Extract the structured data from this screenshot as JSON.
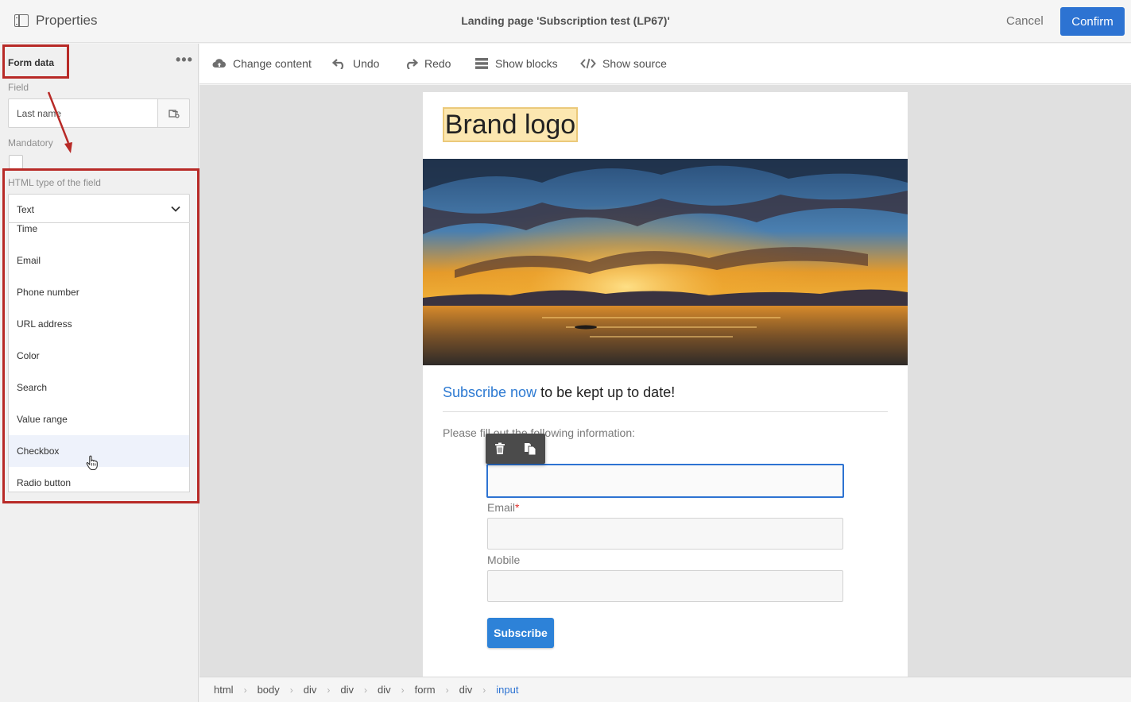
{
  "header": {
    "properties_label": "Properties",
    "title": "Landing page 'Subscription test (LP67)'",
    "cancel_label": "Cancel",
    "confirm_label": "Confirm"
  },
  "panel": {
    "section_title": "Form data",
    "more_icon": "ellipsis-icon",
    "field_label": "Field",
    "field_value": "Last name",
    "mandatory_label": "Mandatory",
    "mandatory_checked": false,
    "html_type_label": "HTML type of the field",
    "html_type_selected": "Text",
    "options": [
      "Time",
      "Email",
      "Phone number",
      "URL address",
      "Color",
      "Search",
      "Value range",
      "Checkbox",
      "Radio button"
    ],
    "hovered_option": "Checkbox"
  },
  "toolbar": {
    "change_content": "Change content",
    "undo": "Undo",
    "redo": "Redo",
    "show_blocks": "Show blocks",
    "show_source": "Show source"
  },
  "page": {
    "logo_text": "Brand logo",
    "subscribe_link": "Subscribe now",
    "subscribe_rest": " to be kept up to date!",
    "fill_info": "Please fill out the following information:",
    "email_label": "Email",
    "required_mark": "*",
    "mobile_label": "Mobile",
    "subscribe_button": "Subscribe"
  },
  "breadcrumb": [
    "html",
    "body",
    "div",
    "div",
    "div",
    "form",
    "div",
    "input"
  ],
  "colors": {
    "accent": "#2d73d2",
    "highlight_box": "#b82a27",
    "link": "#2d7ad2"
  }
}
